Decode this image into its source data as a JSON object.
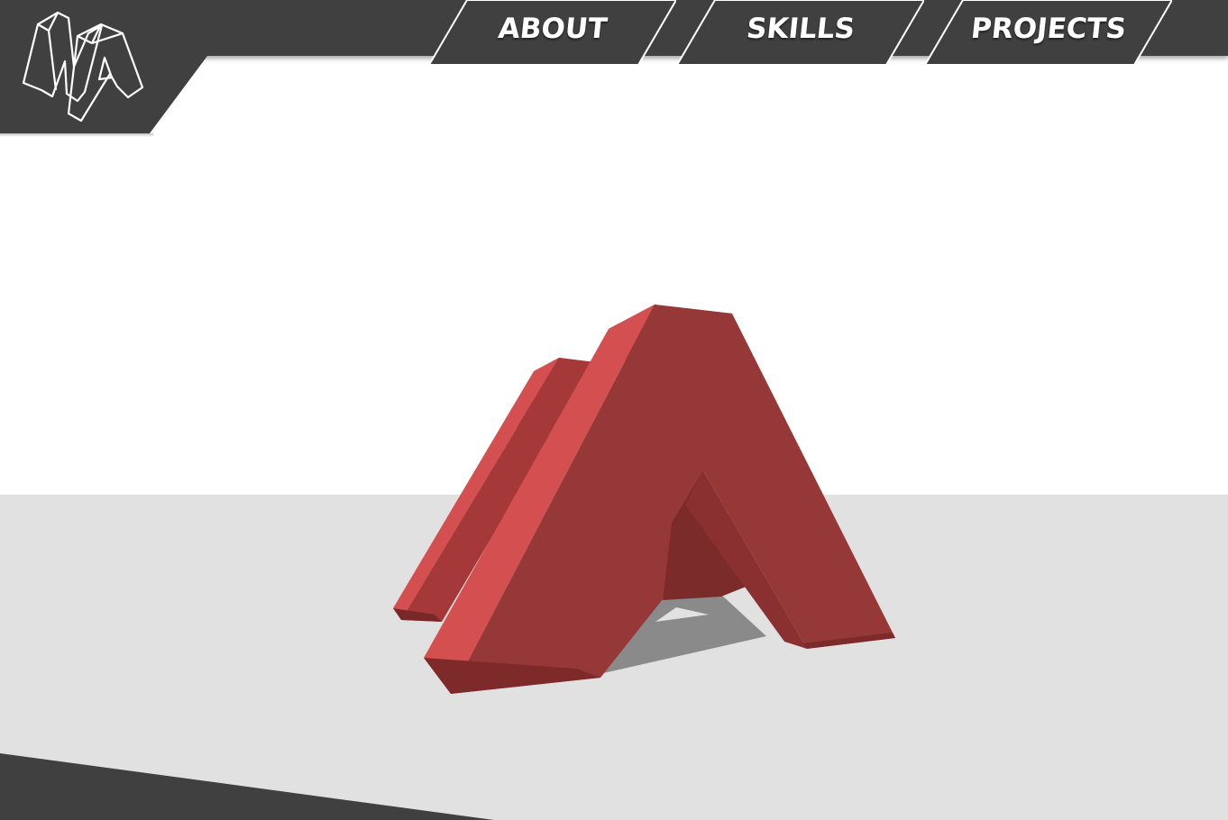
{
  "nav": {
    "items": [
      {
        "label": "ABOUT"
      },
      {
        "label": "SKILLS"
      },
      {
        "label": "PROJECTS"
      }
    ]
  },
  "logo": {
    "icon": "na-monogram-icon"
  },
  "scene": {
    "model": "3d-na-letters",
    "model_color": "#c84646",
    "floor_color": "#e1e1e1",
    "chrome_color": "#404040"
  }
}
